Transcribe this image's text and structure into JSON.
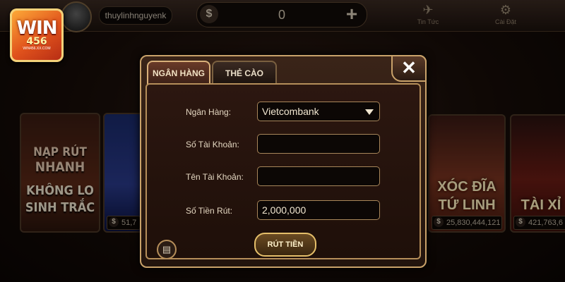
{
  "header": {
    "logo": {
      "main": "WIN",
      "number": "456",
      "url": "WIN456.XX.COM"
    },
    "username": "thuylinhnguyenk",
    "balance": {
      "currency_icon": "$",
      "value": "0",
      "add_icon": "+"
    },
    "news": {
      "icon": "paper-plane-icon",
      "label": "Tin Tức"
    },
    "settings": {
      "icon": "gear-icon",
      "label": "Cài Đặt"
    }
  },
  "background": {
    "promo_card": {
      "lines": [
        "NẠP RÚT",
        "NHANH",
        "KHÔNG LO",
        "SINH TRẮC"
      ]
    },
    "game_card_2": {
      "jackpot": "51,7"
    },
    "game_card_3": {
      "title_line1": "XÓC ĐĨA",
      "title_line2": "TỨ LINH",
      "jackpot": "25,830,444,121"
    },
    "game_card_4": {
      "title": "TÀI XỈ",
      "jackpot": "421,763,6"
    }
  },
  "dialog": {
    "tabs": [
      {
        "label": "NGÂN HÀNG",
        "active": true
      },
      {
        "label": "THẺ CÀO",
        "active": false
      }
    ],
    "close_icon": "✕",
    "form": {
      "bank": {
        "label": "Ngân Hàng:",
        "value": "Vietcombank"
      },
      "account_number": {
        "label": "Số Tài Khoản:",
        "value": ""
      },
      "account_name": {
        "label": "Tên Tài Khoản:",
        "value": ""
      },
      "amount": {
        "label": "Số Tiền Rút:",
        "value": "2,000,000"
      }
    },
    "submit_label": "RÚT TIỀN",
    "history_icon": "document-icon"
  }
}
